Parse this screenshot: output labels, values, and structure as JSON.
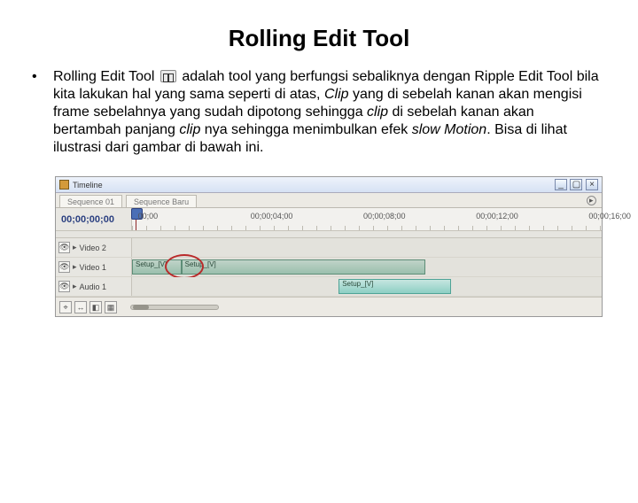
{
  "title": "Rolling Edit Tool",
  "body": {
    "lead": "Rolling Edit Tool ",
    "icon_name": "rolling-edit-tool-icon",
    "text": " adalah tool yang berfungsi sebaliknya dengan Ripple Edit Tool bila kita lakukan hal yang sama seperti di atas, ",
    "italic1": "Clip",
    "text2": " yang di sebelah kanan akan mengisi frame sebelahnya yang sudah dipotong sehingga ",
    "italic2": "clip",
    "text3": " di sebelah kanan akan bertambah panjang ",
    "italic3": "clip",
    "text4": " nya sehingga menimbulkan efek ",
    "italic4": "slow Motion",
    "text5": ". Bisa di lihat ilustrasi dari gambar di bawah ini."
  },
  "panel": {
    "window_title": "Timeline",
    "tabs": [
      "Sequence 01",
      "Sequence Baru"
    ],
    "playhead_time": "00;00;00;00",
    "ruler": [
      {
        "label": "00;00",
        "pct": 2
      },
      {
        "label": "00;00;04;00",
        "pct": 26
      },
      {
        "label": "00;00;08;00",
        "pct": 50
      },
      {
        "label": "00;00;12;00",
        "pct": 74
      },
      {
        "label": "00;00;16;00",
        "pct": 98
      }
    ],
    "tracks": [
      {
        "name": "Video 2",
        "clips": []
      },
      {
        "name": "Video 1",
        "clips": [
          {
            "label": "Setup_[V]",
            "left_pct": 0,
            "width_pct": 10.5
          },
          {
            "label": "Setup_[V]",
            "left_pct": 10.5,
            "width_pct": 52
          }
        ]
      },
      {
        "name": "Audio 1",
        "clips": [
          {
            "label": "Setup_[V]",
            "left_pct": 44,
            "width_pct": 24,
            "bright": true
          }
        ]
      }
    ]
  }
}
